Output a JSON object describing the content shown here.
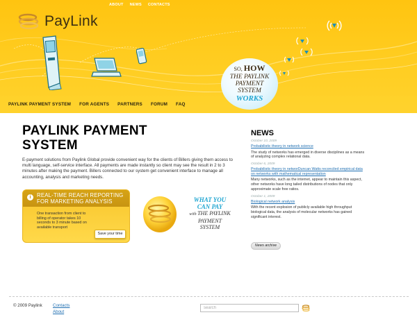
{
  "top_links": [
    {
      "label": "ABOUT"
    },
    {
      "label": "NEWS"
    },
    {
      "label": "CONTACTS"
    }
  ],
  "brand": {
    "name": "PayLink"
  },
  "how_bubble": {
    "so": "SO,",
    "how": "HOW",
    "line1": "THE PAYLINK",
    "line2": "PAYMENT",
    "line3": "SYSTEM",
    "works": "WORKS"
  },
  "main_nav": [
    {
      "label": "PAYLINK PAYMENT SYSTEM"
    },
    {
      "label": "FOR AGENTS"
    },
    {
      "label": "PARTNERS"
    },
    {
      "label": "FORUM"
    },
    {
      "label": "FAQ"
    }
  ],
  "page_title": "PAYLINK PAYMENT SYSTEM",
  "intro": "E-payment solutions from Paylink Global provide convenient way for the clients of Billers giving them access to multi language, self-service interface. All payments are made instantly so client may see the result in 2 to 3 minutes after making the payment. Billers connected to our system get convenient interface to manage all accounting, analysis and marketing needs.",
  "promo": {
    "title": "REAL-TIME REACH REPORTING FOR MARKETING ANALYSIS",
    "text": "One transaction from client to billing of operator takes 10 seconds to 3 minute based on available transport",
    "button": "Save your time"
  },
  "what_you_can_pay": {
    "line1": "WHAT YOU",
    "line2": "CAN PAY",
    "with": "with",
    "line3": "THE PAYLINK",
    "line4": "PAYMENT",
    "line5": "SYSTEM"
  },
  "news": {
    "title": "NEWS",
    "items": [
      {
        "date": "October 10, 2009",
        "link": "Probabilistic theory in network science",
        "text": "The study of networks has emerged in diverse disciplines as a means of analyzing complex relational data."
      },
      {
        "date": "October 6, 2009",
        "link": "Probabilistic theory in networDuncan Watts reconciled empirical data on networks with mathematical representation",
        "text": "Many networks, such as the internet, appear to maintain this aspect, other networks have long tailed distributions of nodes that only approximate scale free ratios."
      },
      {
        "date": "October 1, 2009",
        "link": "Biological network analysis",
        "text": "With the recent explosion of publicly available high throughput biological data, the analysis of molecular networks has gained significant interest."
      }
    ],
    "archive_label": "News archive"
  },
  "footer": {
    "copyright": "© 2009 Paylink",
    "links": [
      {
        "label": "Contacts"
      },
      {
        "label": "About"
      }
    ],
    "search_placeholder": "search"
  },
  "colors": {
    "header_yellow": "#ffc410",
    "accent_blue": "#21a6d1",
    "link_blue": "#1f6fb2"
  }
}
